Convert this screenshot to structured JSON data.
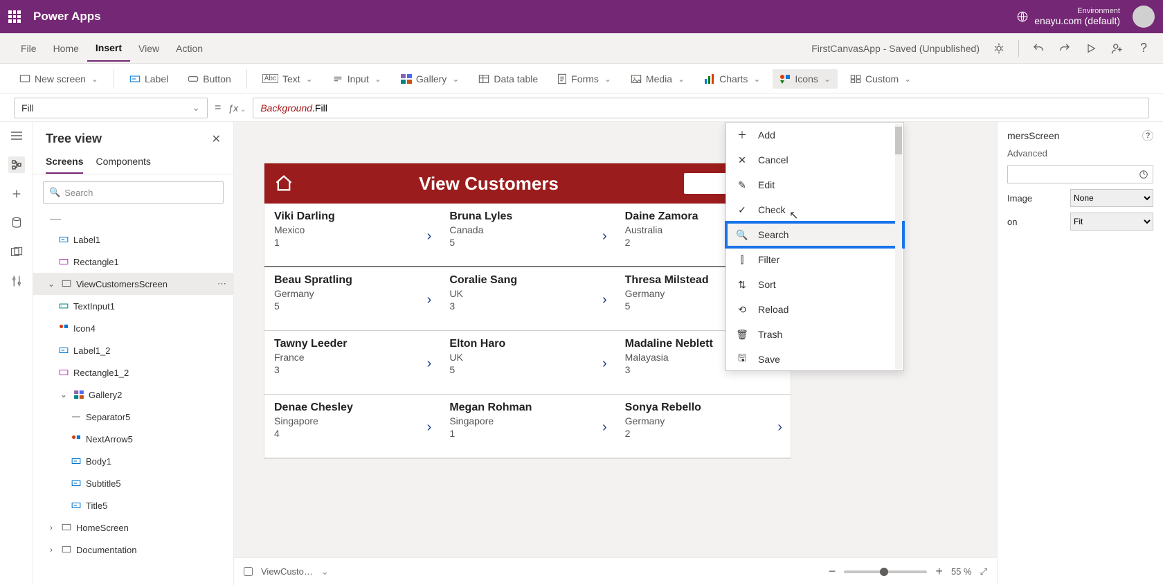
{
  "titlebar": {
    "app_name": "Power Apps",
    "env_label": "Environment",
    "env_value": "enayu.com (default)"
  },
  "menubar": {
    "items": [
      "File",
      "Home",
      "Insert",
      "View",
      "Action"
    ],
    "active_index": 2,
    "doc_status": "FirstCanvasApp - Saved (Unpublished)"
  },
  "ribbon": {
    "new_screen": "New screen",
    "label": "Label",
    "button": "Button",
    "text": "Text",
    "input": "Input",
    "gallery": "Gallery",
    "data_table": "Data table",
    "forms": "Forms",
    "media": "Media",
    "charts": "Charts",
    "icons": "Icons",
    "custom": "Custom"
  },
  "formula": {
    "property": "Fill",
    "expr_a": "Background",
    "expr_b": ".Fill"
  },
  "treeview": {
    "title": "Tree view",
    "tabs": [
      "Screens",
      "Components"
    ],
    "active_tab": 0,
    "search_placeholder": "Search",
    "items": [
      {
        "label": "Label1",
        "indent": 1,
        "icon": "label"
      },
      {
        "label": "Rectangle1",
        "indent": 1,
        "icon": "rect"
      },
      {
        "label": "ViewCustomersScreen",
        "indent": 0,
        "icon": "screen",
        "selected": true,
        "expand": "open"
      },
      {
        "label": "TextInput1",
        "indent": 1,
        "icon": "textinput"
      },
      {
        "label": "Icon4",
        "indent": 1,
        "icon": "icon"
      },
      {
        "label": "Label1_2",
        "indent": 1,
        "icon": "label"
      },
      {
        "label": "Rectangle1_2",
        "indent": 1,
        "icon": "rect"
      },
      {
        "label": "Gallery2",
        "indent": 1,
        "icon": "gallery",
        "expand": "open"
      },
      {
        "label": "Separator5",
        "indent": 2,
        "icon": "sep"
      },
      {
        "label": "NextArrow5",
        "indent": 2,
        "icon": "icon"
      },
      {
        "label": "Body1",
        "indent": 2,
        "icon": "label"
      },
      {
        "label": "Subtitle5",
        "indent": 2,
        "icon": "label"
      },
      {
        "label": "Title5",
        "indent": 2,
        "icon": "label"
      },
      {
        "label": "HomeScreen",
        "indent": 0,
        "icon": "screen",
        "expand": "closed"
      },
      {
        "label": "Documentation",
        "indent": 0,
        "icon": "screen",
        "expand": "closed"
      }
    ]
  },
  "canvas": {
    "header_title": "View Customers",
    "cards": [
      {
        "name": "Viki  Darling",
        "country": "Mexico",
        "num": "1"
      },
      {
        "name": "Bruna  Lyles",
        "country": "Canada",
        "num": "5"
      },
      {
        "name": "Daine  Zamora",
        "country": "Australia",
        "num": "2"
      },
      {
        "name": "Beau  Spratling",
        "country": "Germany",
        "num": "5"
      },
      {
        "name": "Coralie  Sang",
        "country": "UK",
        "num": "3"
      },
      {
        "name": "Thresa  Milstead",
        "country": "Germany",
        "num": "5"
      },
      {
        "name": "Tawny  Leeder",
        "country": "France",
        "num": "3"
      },
      {
        "name": "Elton  Haro",
        "country": "UK",
        "num": "5"
      },
      {
        "name": "Madaline  Neblett",
        "country": "Malayasia",
        "num": "3"
      },
      {
        "name": "Denae  Chesley",
        "country": "Singapore",
        "num": "4"
      },
      {
        "name": "Megan  Rohman",
        "country": "Singapore",
        "num": "1"
      },
      {
        "name": "Sonya  Rebello",
        "country": "Germany",
        "num": "2"
      }
    ]
  },
  "dropdown": {
    "items": [
      {
        "icon": "＋",
        "label": "Add"
      },
      {
        "icon": "✕",
        "label": "Cancel"
      },
      {
        "icon": "✎",
        "label": "Edit"
      },
      {
        "icon": "✓",
        "label": "Check"
      },
      {
        "icon": "🔍",
        "label": "Search",
        "highlight": true
      },
      {
        "icon": "⫿",
        "label": "Filter"
      },
      {
        "icon": "⇅",
        "label": "Sort"
      },
      {
        "icon": "⟲",
        "label": "Reload"
      },
      {
        "icon": "🗑",
        "label": "Trash"
      },
      {
        "icon": "🖫",
        "label": "Save"
      }
    ]
  },
  "proppanel": {
    "heading_suffix": "mersScreen",
    "tab": "Advanced",
    "image_label": "Image",
    "image_value": "None",
    "fit_label": "on",
    "fit_value": "Fit"
  },
  "statusbar": {
    "breadcrumb": "ViewCusto…",
    "zoom": "55",
    "zoom_unit": "%"
  }
}
